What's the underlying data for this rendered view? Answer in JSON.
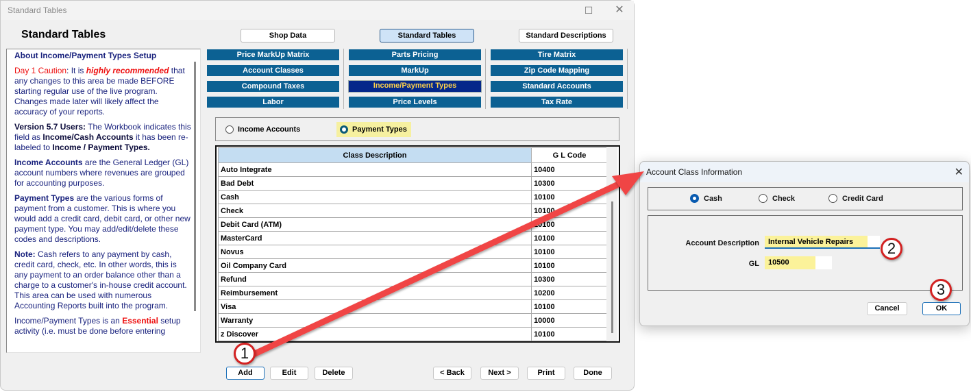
{
  "window": {
    "title": "Standard Tables",
    "page_title": "Standard Tables",
    "maximize_icon": "maximize-icon",
    "close_icon": "close-icon"
  },
  "help": {
    "heading": "About Income/Payment Types Setup",
    "p1": {
      "caution": "Day 1 Caution",
      "colon": ": It is ",
      "emph": "highly recommended",
      "rest": " that any changes to this area be made BEFORE starting regular use of the live program. Changes made later will likely affect the accuracy of your reports."
    },
    "p2": {
      "lead": "Version 5.7 Users:",
      "t1": " The Workbook indicates this field as ",
      "b1": "Income/Cash Accounts",
      "t2": " it has been re-labeled to ",
      "b2": "Income / Payment Types."
    },
    "p3": {
      "lead": "Income Accounts",
      "rest": " are the General Ledger (GL) account numbers where revenues are grouped for accounting purposes."
    },
    "p4": {
      "lead": "Payment Types",
      "rest": " are the various forms of payment from a customer. This is where you would add a credit card, debit card, or other new payment type. You may add/edit/delete these codes and descriptions."
    },
    "p5": {
      "lead": "Note:",
      "rest": " Cash refers to any payment by cash, credit card, check, etc. In other words, this is any payment to an order balance other than a charge to a customer's in-house credit account. This area can be used with numerous Accounting Reports built into the program."
    },
    "p6": {
      "t1": "Income/Payment Types is an ",
      "essential": "Essential",
      "t2": " setup activity (i.e. must be done before entering"
    }
  },
  "top_tabs": [
    {
      "label": "Shop Data",
      "active": false
    },
    {
      "label": "Standard Tables",
      "active": true
    },
    {
      "label": "Standard Descriptions",
      "active": false
    }
  ],
  "nav": [
    {
      "label": "Price MarkUp Matrix",
      "active": false
    },
    {
      "label": "Parts Pricing",
      "active": false
    },
    {
      "label": "Tire Matrix",
      "active": false
    },
    {
      "label": "Account Classes",
      "active": false
    },
    {
      "label": "MarkUp",
      "active": false
    },
    {
      "label": "Zip Code Mapping",
      "active": false
    },
    {
      "label": "Compound Taxes",
      "active": false
    },
    {
      "label": "Income/Payment Types",
      "active": true
    },
    {
      "label": "Standard Accounts",
      "active": false
    },
    {
      "label": "Labor",
      "active": false
    },
    {
      "label": "Price Levels",
      "active": false
    },
    {
      "label": "Tax Rate",
      "active": false
    }
  ],
  "type_filter": {
    "options": [
      "Income Accounts",
      "Payment Types"
    ],
    "selected": "Payment Types"
  },
  "table": {
    "columns": [
      "Class Description",
      "G L Code"
    ],
    "rows": [
      [
        "Auto Integrate",
        "10400"
      ],
      [
        "Bad Debt",
        "10300"
      ],
      [
        "Cash",
        "10100"
      ],
      [
        "Check",
        "10100"
      ],
      [
        "Debit Card (ATM)",
        "10100"
      ],
      [
        "MasterCard",
        "10100"
      ],
      [
        "Novus",
        "10100"
      ],
      [
        "Oil Company Card",
        "10100"
      ],
      [
        "Refund",
        "10300"
      ],
      [
        "Reimbursement",
        "10200"
      ],
      [
        "Visa",
        "10100"
      ],
      [
        "Warranty",
        "10000"
      ],
      [
        "z Discover",
        "10100"
      ]
    ]
  },
  "buttons": {
    "add": "Add",
    "edit": "Edit",
    "delete": "Delete",
    "back": "< Back",
    "next": "Next >",
    "print": "Print",
    "done": "Done"
  },
  "dialog": {
    "title": "Account Class Information",
    "close_icon": "close-icon",
    "types": [
      "Cash",
      "Check",
      "Credit Card"
    ],
    "selected_type": "Cash",
    "account_description_label": "Account Description",
    "account_description_value": "Internal Vehicle Repairs",
    "gl_label": "GL",
    "gl_value": "10500",
    "cancel": "Cancel",
    "ok": "OK"
  },
  "annotations": {
    "steps": [
      "1",
      "2",
      "3"
    ],
    "arrow_color": "#f04545"
  }
}
